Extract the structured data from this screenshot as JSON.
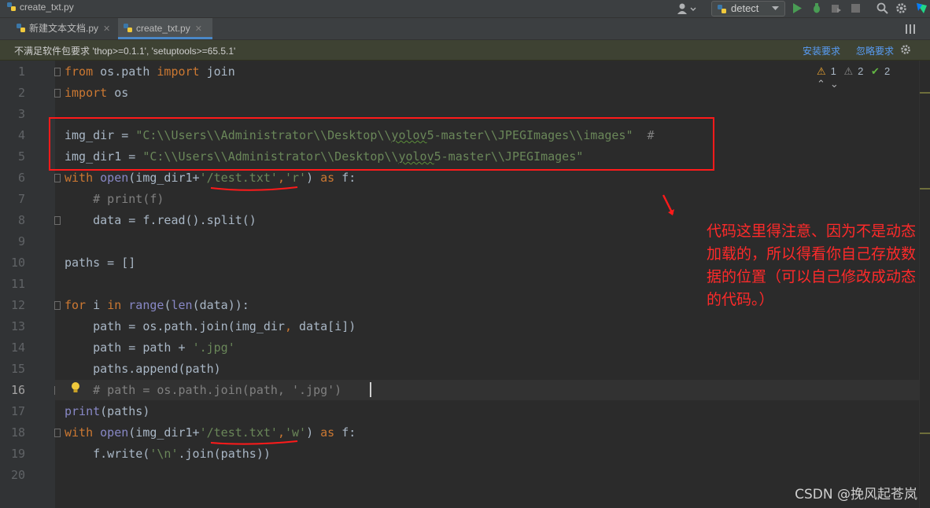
{
  "window": {
    "title": "create_txt.py"
  },
  "toolbar": {
    "run_config": "detect"
  },
  "tabs": [
    {
      "label": "新建文本文档.py"
    },
    {
      "label": "create_txt.py"
    }
  ],
  "banner": {
    "message": "不满足软件包要求 'thop>=0.1.1', 'setuptools>=65.5.1'",
    "install": "安装要求",
    "ignore": "忽略要求"
  },
  "inspections": {
    "warnings": "1",
    "weak_warnings": "2",
    "typos": "2"
  },
  "code": {
    "l1": {
      "a": "from",
      "b": " os.path ",
      "c": "import",
      "d": " join"
    },
    "l2": {
      "a": "import",
      "b": " os"
    },
    "l4": {
      "a": "img_dir = ",
      "b": "\"C:\\\\Users\\\\Administrator\\\\Desktop\\\\",
      "c": "yolov",
      "d": "5-master\\\\JPEGImages\\\\images\"",
      "e": "  #"
    },
    "l5": {
      "a": "img_dir1 = ",
      "b": "\"C:\\\\Users\\\\Administrator\\\\Desktop\\\\",
      "c": "yolov",
      "d": "5-master\\\\JPEGImages\""
    },
    "l6": {
      "a": "with",
      "b": " ",
      "c": "open",
      "d": "(img_dir1+",
      "e": "'/test.txt'",
      "f": ",",
      "g": "'r'",
      "h": ") ",
      "i": "as",
      "j": " f:"
    },
    "l7": {
      "a": "    # print(f)"
    },
    "l8": {
      "a": "    data = f.read().split()"
    },
    "l10": {
      "a": "paths = []"
    },
    "l12": {
      "a": "for",
      "b": " i ",
      "c": "in",
      "d": " ",
      "e": "range",
      "f": "(",
      "g": "len",
      "h": "(data)):"
    },
    "l13": {
      "a": "    path = os.path.join(img_dir",
      "b": ",",
      "c": " data[i])"
    },
    "l14": {
      "a": "    path = path + ",
      "b": "'.jpg'"
    },
    "l15": {
      "a": "    paths.append(path)"
    },
    "l16": {
      "a": "    # path = os.path.join(path, '.jpg')"
    },
    "l17": {
      "a": "print",
      "b": "(paths)"
    },
    "l18": {
      "a": "with",
      "b": " ",
      "c": "open",
      "d": "(img_dir1+",
      "e": "'/test.txt'",
      "f": ",",
      "g": "'w'",
      "h": ") ",
      "i": "as",
      "j": " f:"
    },
    "l19": {
      "a": "    f.write(",
      "b": "'\\n'",
      "c": ".join(paths))"
    }
  },
  "annotation": {
    "text": "代码这里得注意、因为不是动态加载的，所以得看你自己存放数据的位置（可以自己修改成动态的代码。）"
  },
  "watermark": "CSDN @挽风起苍岚",
  "colors": {
    "annotation_red": "#ff1a1a",
    "keyword": "#cc7832",
    "string": "#6a8759",
    "comment": "#808080"
  }
}
